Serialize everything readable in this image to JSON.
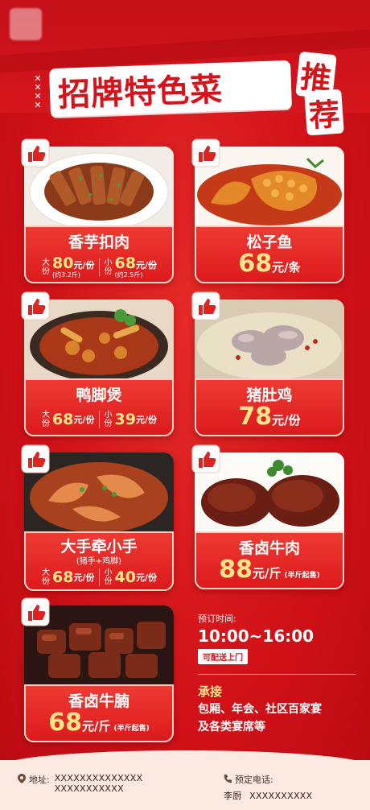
{
  "header": {
    "title": "招牌特色菜",
    "title_side_1": "推",
    "title_side_2": "荐"
  },
  "colors": {
    "primary_red": "#d6121a",
    "price_yellow": "#ffe58a",
    "footer_bg": "#fbe9e2"
  },
  "dishes": [
    {
      "name": "香芋扣肉",
      "big_label": "大份",
      "big_price": "80",
      "big_unit": "元/份",
      "big_sub": "(约3.2斤)",
      "small_label": "小份",
      "small_price": "68",
      "small_unit": "元/份",
      "small_sub": "(约2.5斤)"
    },
    {
      "name": "松子鱼",
      "price": "68",
      "unit": "元/条"
    },
    {
      "name": "鸭脚煲",
      "big_label": "大份",
      "big_price": "68",
      "big_unit": "元/份",
      "small_label": "小份",
      "small_price": "39",
      "small_unit": "元/份"
    },
    {
      "name": "猪肚鸡",
      "price": "78",
      "unit": "元/份"
    },
    {
      "name": "大手牵小手",
      "note": "(猪手+鸡脚)",
      "big_label": "大份",
      "big_price": "68",
      "big_unit": "元/份",
      "small_label": "小份",
      "small_price": "40",
      "small_unit": "元/份"
    },
    {
      "name": "香卤牛肉",
      "price": "88",
      "unit": "元/斤",
      "extra": "(半斤起售)"
    },
    {
      "name": "香卤牛腩",
      "price": "68",
      "unit": "元/斤",
      "extra": "(半斤起售)"
    }
  ],
  "booking": {
    "label": "预订时间:",
    "time": "10:00~16:00",
    "delivery": "可配送上门",
    "service_title": "承接",
    "service_line_1": "包厢、年会、社区百家宴",
    "service_line_2": "及各类宴席等"
  },
  "footer": {
    "address_label": "地址:",
    "address_line_1": "XXXXXXXXXXXXXX",
    "address_line_2": "XXXXXXXXXXX",
    "phone_label": "预定电话:",
    "phone_name": "李厨",
    "phone_number": "XXXXXXXXXX"
  },
  "icons": [
    "thumbs-up-icon",
    "location-pin-icon",
    "phone-icon",
    "logo-icon"
  ]
}
